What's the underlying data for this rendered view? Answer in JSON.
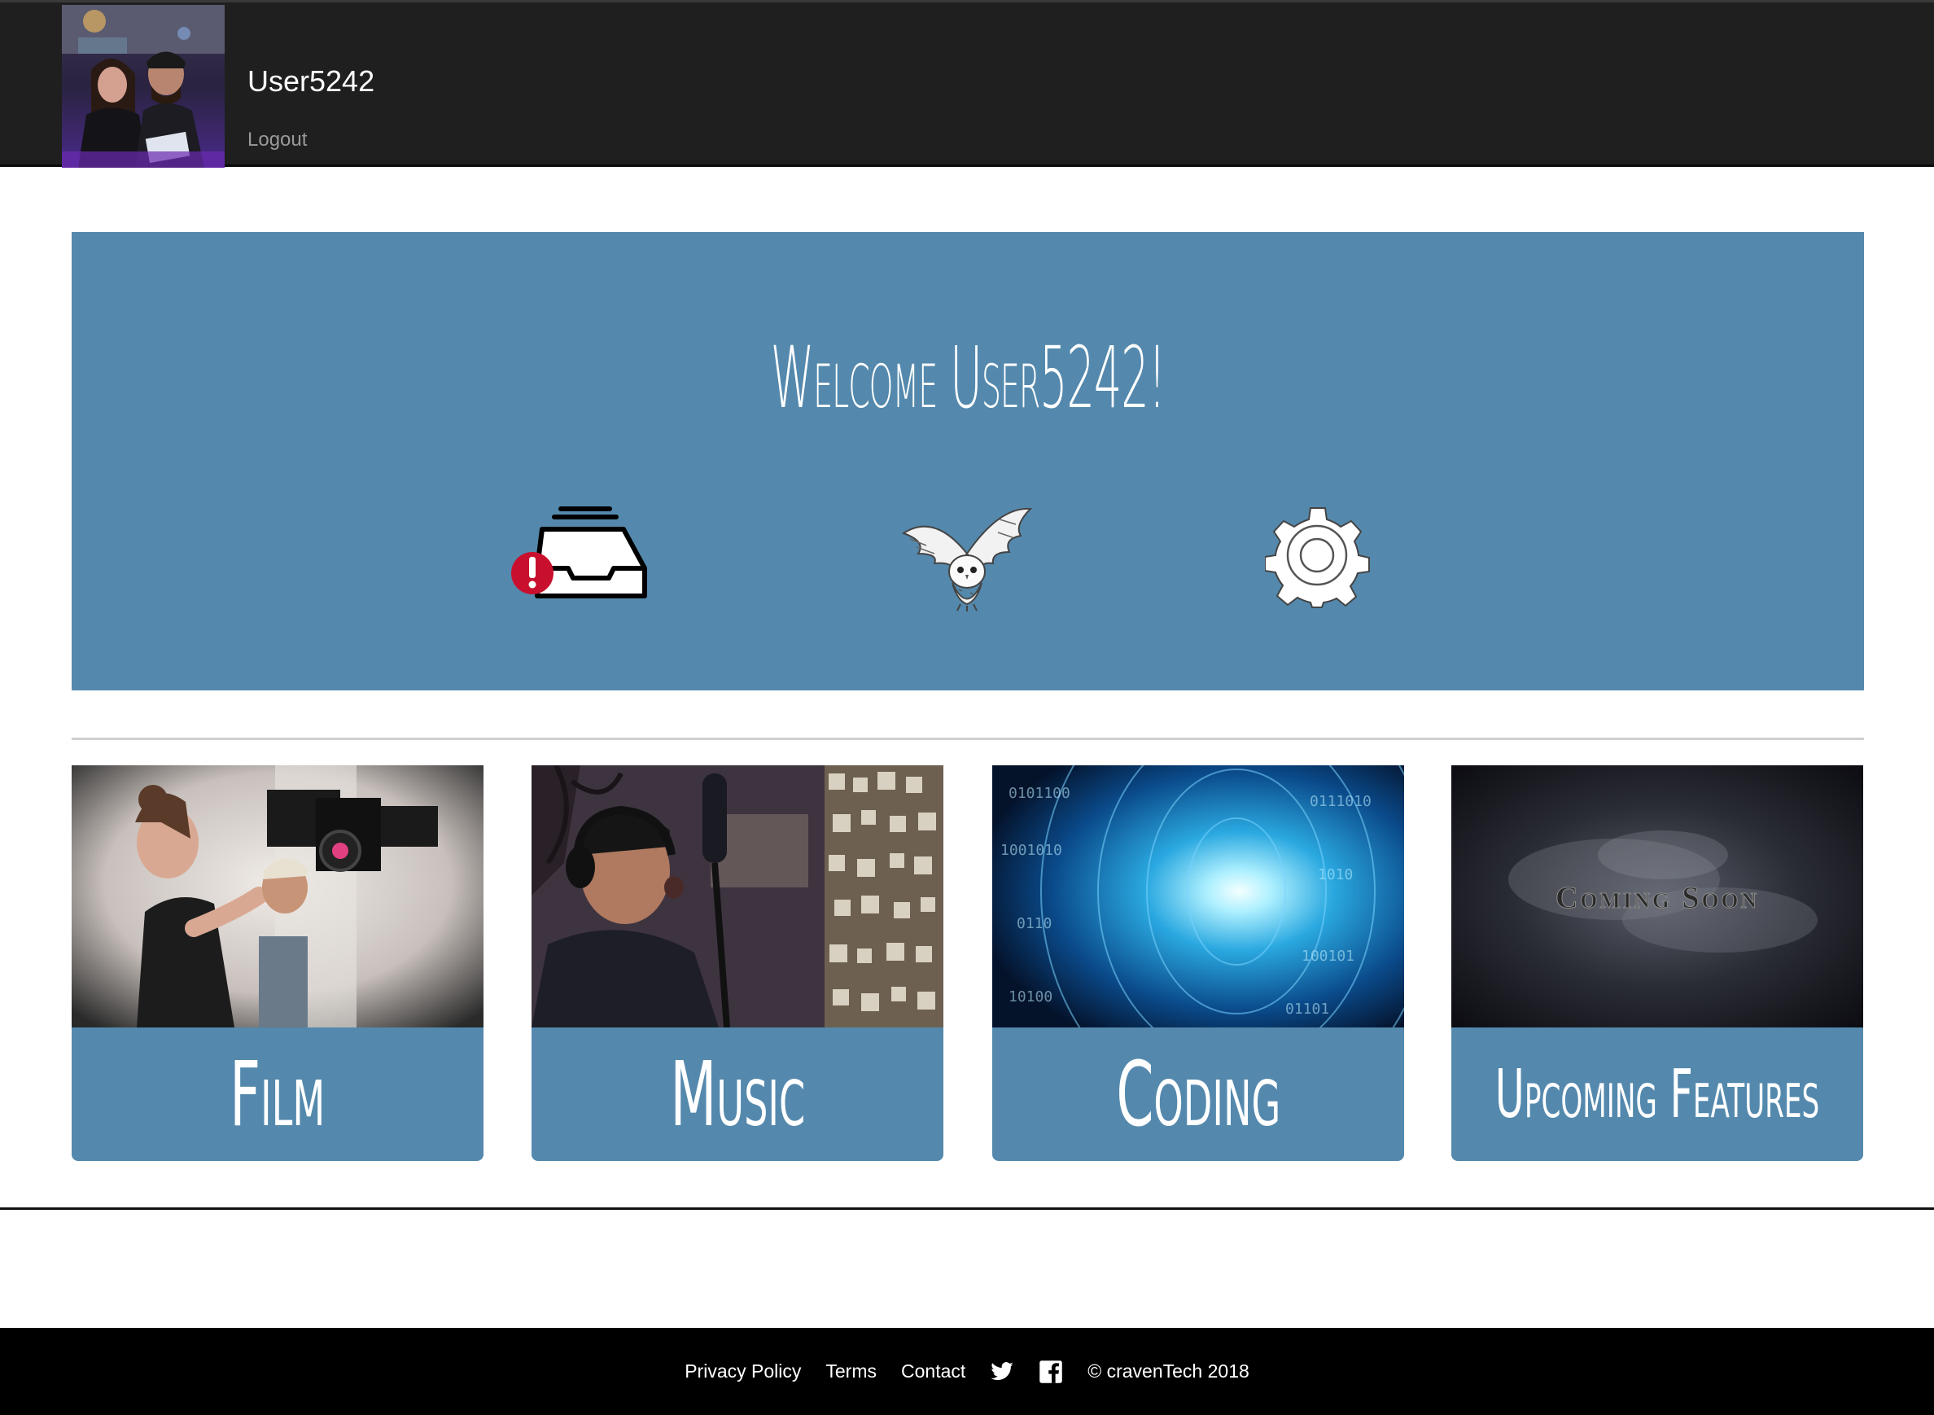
{
  "header": {
    "username": "User5242",
    "logout_label": "Logout"
  },
  "hero": {
    "welcome_text": "Welcome User5242!",
    "icons": [
      "inbox-alert-icon",
      "owl-icon",
      "gear-icon"
    ]
  },
  "cards": [
    {
      "label": "Film"
    },
    {
      "label": "Music"
    },
    {
      "label": "Coding"
    },
    {
      "label": "Upcoming Features",
      "image_text": "Coming Soon"
    }
  ],
  "footer": {
    "links": [
      "Privacy Policy",
      "Terms",
      "Contact"
    ],
    "copyright": "© cravenTech 2018",
    "social_icons": [
      "twitter-icon",
      "facebook-icon"
    ]
  },
  "colors": {
    "topbar": "#1f1f1f",
    "accent": "#5489ad",
    "footer": "#000000",
    "alert": "#c8102e"
  }
}
